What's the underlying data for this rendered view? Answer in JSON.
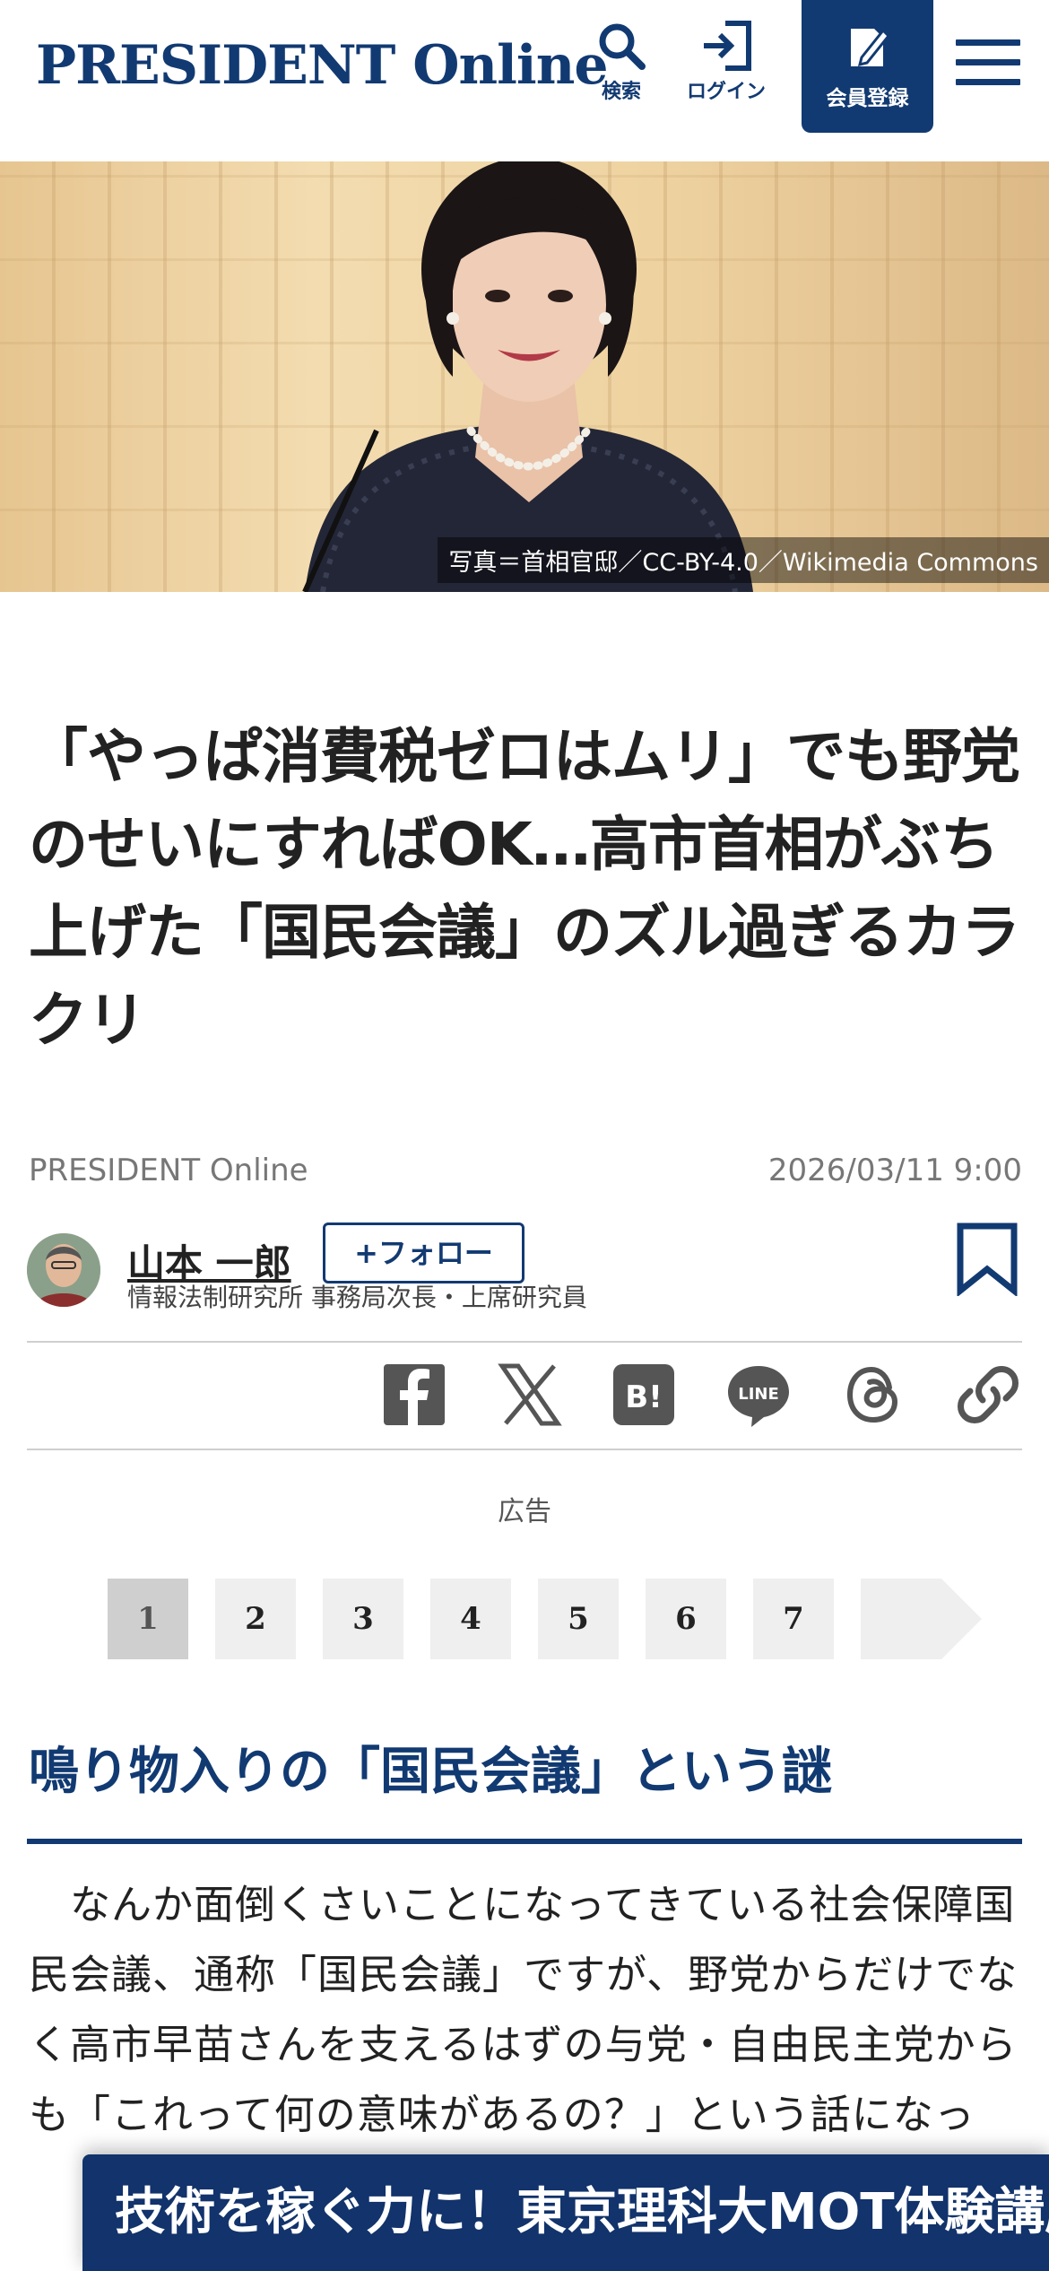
{
  "header": {
    "logo": "PRESIDENT Online",
    "search_label": "検索",
    "login_label": "ログイン",
    "signup_label": "会員登録"
  },
  "hero": {
    "caption": "写真＝首相官邸／CC-BY-4.0／Wikimedia Commons"
  },
  "article": {
    "title": "「やっぱ消費税ゼロはムリ」でも野党のせいにすればOK…高市首相がぶち上げた「国民会議」のズル過ぎるカラクリ",
    "source": "PRESIDENT Online",
    "date": "2026/03/11 9:00",
    "author": {
      "name": "山本 一郎",
      "follow_label": "+フォロー",
      "role": "情報法制研究所 事務局次長・上席研究員"
    },
    "share_icons": [
      "facebook-icon",
      "x-icon",
      "hatena-bookmark-icon",
      "line-icon",
      "threads-icon",
      "copy-link-icon"
    ],
    "ad_label": "広告",
    "pagination": {
      "pages": [
        "1",
        "2",
        "3",
        "4",
        "5",
        "6",
        "7"
      ],
      "current": "1"
    },
    "section_heading": "鳴り物入りの「国民会議」という謎",
    "body": "　なんか面倒くさいことになってきている社会保障国民会議、通称「国民会議」ですが、野党からだけでなく高市早苗さんを支えるはずの与党・自由民主党からも「これって何の意味があるの？」という話になっ"
  },
  "banner": {
    "text": "技術を稼ぐ力に！東京理科大MOT体験講座"
  },
  "colors": {
    "brand_navy": "#123a72",
    "banner_navy": "#12336b"
  }
}
